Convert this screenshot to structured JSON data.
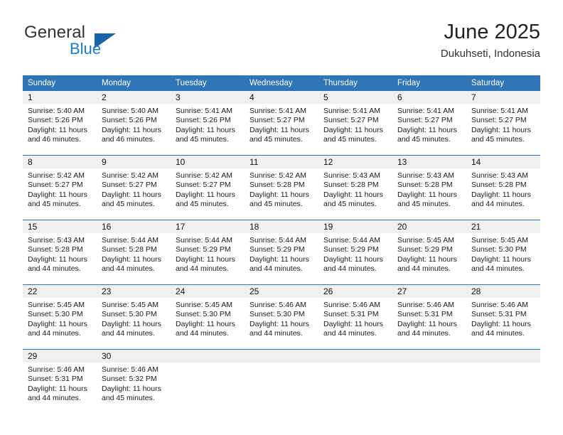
{
  "logo": {
    "word_one": "General",
    "word_two": "Blue",
    "triangle_icon": "blue-triangle-icon",
    "colors": {
      "word_one": "#333333",
      "word_two": "#1a7bc4",
      "triangle": "#1763a8"
    }
  },
  "header": {
    "title": "June 2025",
    "subtitle": "Dukuhseti, Indonesia"
  },
  "theme": {
    "header_blue": "#2E75B6",
    "daynum_gray": "#f0f0f0",
    "text": "#1a1a1a"
  },
  "calendar": {
    "weekday_headers": [
      "Sunday",
      "Monday",
      "Tuesday",
      "Wednesday",
      "Thursday",
      "Friday",
      "Saturday"
    ],
    "labels": {
      "sunrise": "Sunrise:",
      "sunset": "Sunset:",
      "daylight": "Daylight:"
    },
    "weeks": [
      [
        {
          "day": "1",
          "sunrise": "Sunrise: 5:40 AM",
          "sunset": "Sunset: 5:26 PM",
          "daylight_line1": "Daylight: 11 hours",
          "daylight_line2": "and 46 minutes."
        },
        {
          "day": "2",
          "sunrise": "Sunrise: 5:40 AM",
          "sunset": "Sunset: 5:26 PM",
          "daylight_line1": "Daylight: 11 hours",
          "daylight_line2": "and 46 minutes."
        },
        {
          "day": "3",
          "sunrise": "Sunrise: 5:41 AM",
          "sunset": "Sunset: 5:26 PM",
          "daylight_line1": "Daylight: 11 hours",
          "daylight_line2": "and 45 minutes."
        },
        {
          "day": "4",
          "sunrise": "Sunrise: 5:41 AM",
          "sunset": "Sunset: 5:27 PM",
          "daylight_line1": "Daylight: 11 hours",
          "daylight_line2": "and 45 minutes."
        },
        {
          "day": "5",
          "sunrise": "Sunrise: 5:41 AM",
          "sunset": "Sunset: 5:27 PM",
          "daylight_line1": "Daylight: 11 hours",
          "daylight_line2": "and 45 minutes."
        },
        {
          "day": "6",
          "sunrise": "Sunrise: 5:41 AM",
          "sunset": "Sunset: 5:27 PM",
          "daylight_line1": "Daylight: 11 hours",
          "daylight_line2": "and 45 minutes."
        },
        {
          "day": "7",
          "sunrise": "Sunrise: 5:41 AM",
          "sunset": "Sunset: 5:27 PM",
          "daylight_line1": "Daylight: 11 hours",
          "daylight_line2": "and 45 minutes."
        }
      ],
      [
        {
          "day": "8",
          "sunrise": "Sunrise: 5:42 AM",
          "sunset": "Sunset: 5:27 PM",
          "daylight_line1": "Daylight: 11 hours",
          "daylight_line2": "and 45 minutes."
        },
        {
          "day": "9",
          "sunrise": "Sunrise: 5:42 AM",
          "sunset": "Sunset: 5:27 PM",
          "daylight_line1": "Daylight: 11 hours",
          "daylight_line2": "and 45 minutes."
        },
        {
          "day": "10",
          "sunrise": "Sunrise: 5:42 AM",
          "sunset": "Sunset: 5:27 PM",
          "daylight_line1": "Daylight: 11 hours",
          "daylight_line2": "and 45 minutes."
        },
        {
          "day": "11",
          "sunrise": "Sunrise: 5:42 AM",
          "sunset": "Sunset: 5:28 PM",
          "daylight_line1": "Daylight: 11 hours",
          "daylight_line2": "and 45 minutes."
        },
        {
          "day": "12",
          "sunrise": "Sunrise: 5:43 AM",
          "sunset": "Sunset: 5:28 PM",
          "daylight_line1": "Daylight: 11 hours",
          "daylight_line2": "and 45 minutes."
        },
        {
          "day": "13",
          "sunrise": "Sunrise: 5:43 AM",
          "sunset": "Sunset: 5:28 PM",
          "daylight_line1": "Daylight: 11 hours",
          "daylight_line2": "and 45 minutes."
        },
        {
          "day": "14",
          "sunrise": "Sunrise: 5:43 AM",
          "sunset": "Sunset: 5:28 PM",
          "daylight_line1": "Daylight: 11 hours",
          "daylight_line2": "and 44 minutes."
        }
      ],
      [
        {
          "day": "15",
          "sunrise": "Sunrise: 5:43 AM",
          "sunset": "Sunset: 5:28 PM",
          "daylight_line1": "Daylight: 11 hours",
          "daylight_line2": "and 44 minutes."
        },
        {
          "day": "16",
          "sunrise": "Sunrise: 5:44 AM",
          "sunset": "Sunset: 5:28 PM",
          "daylight_line1": "Daylight: 11 hours",
          "daylight_line2": "and 44 minutes."
        },
        {
          "day": "17",
          "sunrise": "Sunrise: 5:44 AM",
          "sunset": "Sunset: 5:29 PM",
          "daylight_line1": "Daylight: 11 hours",
          "daylight_line2": "and 44 minutes."
        },
        {
          "day": "18",
          "sunrise": "Sunrise: 5:44 AM",
          "sunset": "Sunset: 5:29 PM",
          "daylight_line1": "Daylight: 11 hours",
          "daylight_line2": "and 44 minutes."
        },
        {
          "day": "19",
          "sunrise": "Sunrise: 5:44 AM",
          "sunset": "Sunset: 5:29 PM",
          "daylight_line1": "Daylight: 11 hours",
          "daylight_line2": "and 44 minutes."
        },
        {
          "day": "20",
          "sunrise": "Sunrise: 5:45 AM",
          "sunset": "Sunset: 5:29 PM",
          "daylight_line1": "Daylight: 11 hours",
          "daylight_line2": "and 44 minutes."
        },
        {
          "day": "21",
          "sunrise": "Sunrise: 5:45 AM",
          "sunset": "Sunset: 5:30 PM",
          "daylight_line1": "Daylight: 11 hours",
          "daylight_line2": "and 44 minutes."
        }
      ],
      [
        {
          "day": "22",
          "sunrise": "Sunrise: 5:45 AM",
          "sunset": "Sunset: 5:30 PM",
          "daylight_line1": "Daylight: 11 hours",
          "daylight_line2": "and 44 minutes."
        },
        {
          "day": "23",
          "sunrise": "Sunrise: 5:45 AM",
          "sunset": "Sunset: 5:30 PM",
          "daylight_line1": "Daylight: 11 hours",
          "daylight_line2": "and 44 minutes."
        },
        {
          "day": "24",
          "sunrise": "Sunrise: 5:45 AM",
          "sunset": "Sunset: 5:30 PM",
          "daylight_line1": "Daylight: 11 hours",
          "daylight_line2": "and 44 minutes."
        },
        {
          "day": "25",
          "sunrise": "Sunrise: 5:46 AM",
          "sunset": "Sunset: 5:30 PM",
          "daylight_line1": "Daylight: 11 hours",
          "daylight_line2": "and 44 minutes."
        },
        {
          "day": "26",
          "sunrise": "Sunrise: 5:46 AM",
          "sunset": "Sunset: 5:31 PM",
          "daylight_line1": "Daylight: 11 hours",
          "daylight_line2": "and 44 minutes."
        },
        {
          "day": "27",
          "sunrise": "Sunrise: 5:46 AM",
          "sunset": "Sunset: 5:31 PM",
          "daylight_line1": "Daylight: 11 hours",
          "daylight_line2": "and 44 minutes."
        },
        {
          "day": "28",
          "sunrise": "Sunrise: 5:46 AM",
          "sunset": "Sunset: 5:31 PM",
          "daylight_line1": "Daylight: 11 hours",
          "daylight_line2": "and 44 minutes."
        }
      ],
      [
        {
          "day": "29",
          "sunrise": "Sunrise: 5:46 AM",
          "sunset": "Sunset: 5:31 PM",
          "daylight_line1": "Daylight: 11 hours",
          "daylight_line2": "and 44 minutes."
        },
        {
          "day": "30",
          "sunrise": "Sunrise: 5:46 AM",
          "sunset": "Sunset: 5:32 PM",
          "daylight_line1": "Daylight: 11 hours",
          "daylight_line2": "and 45 minutes."
        },
        null,
        null,
        null,
        null,
        null
      ]
    ]
  }
}
